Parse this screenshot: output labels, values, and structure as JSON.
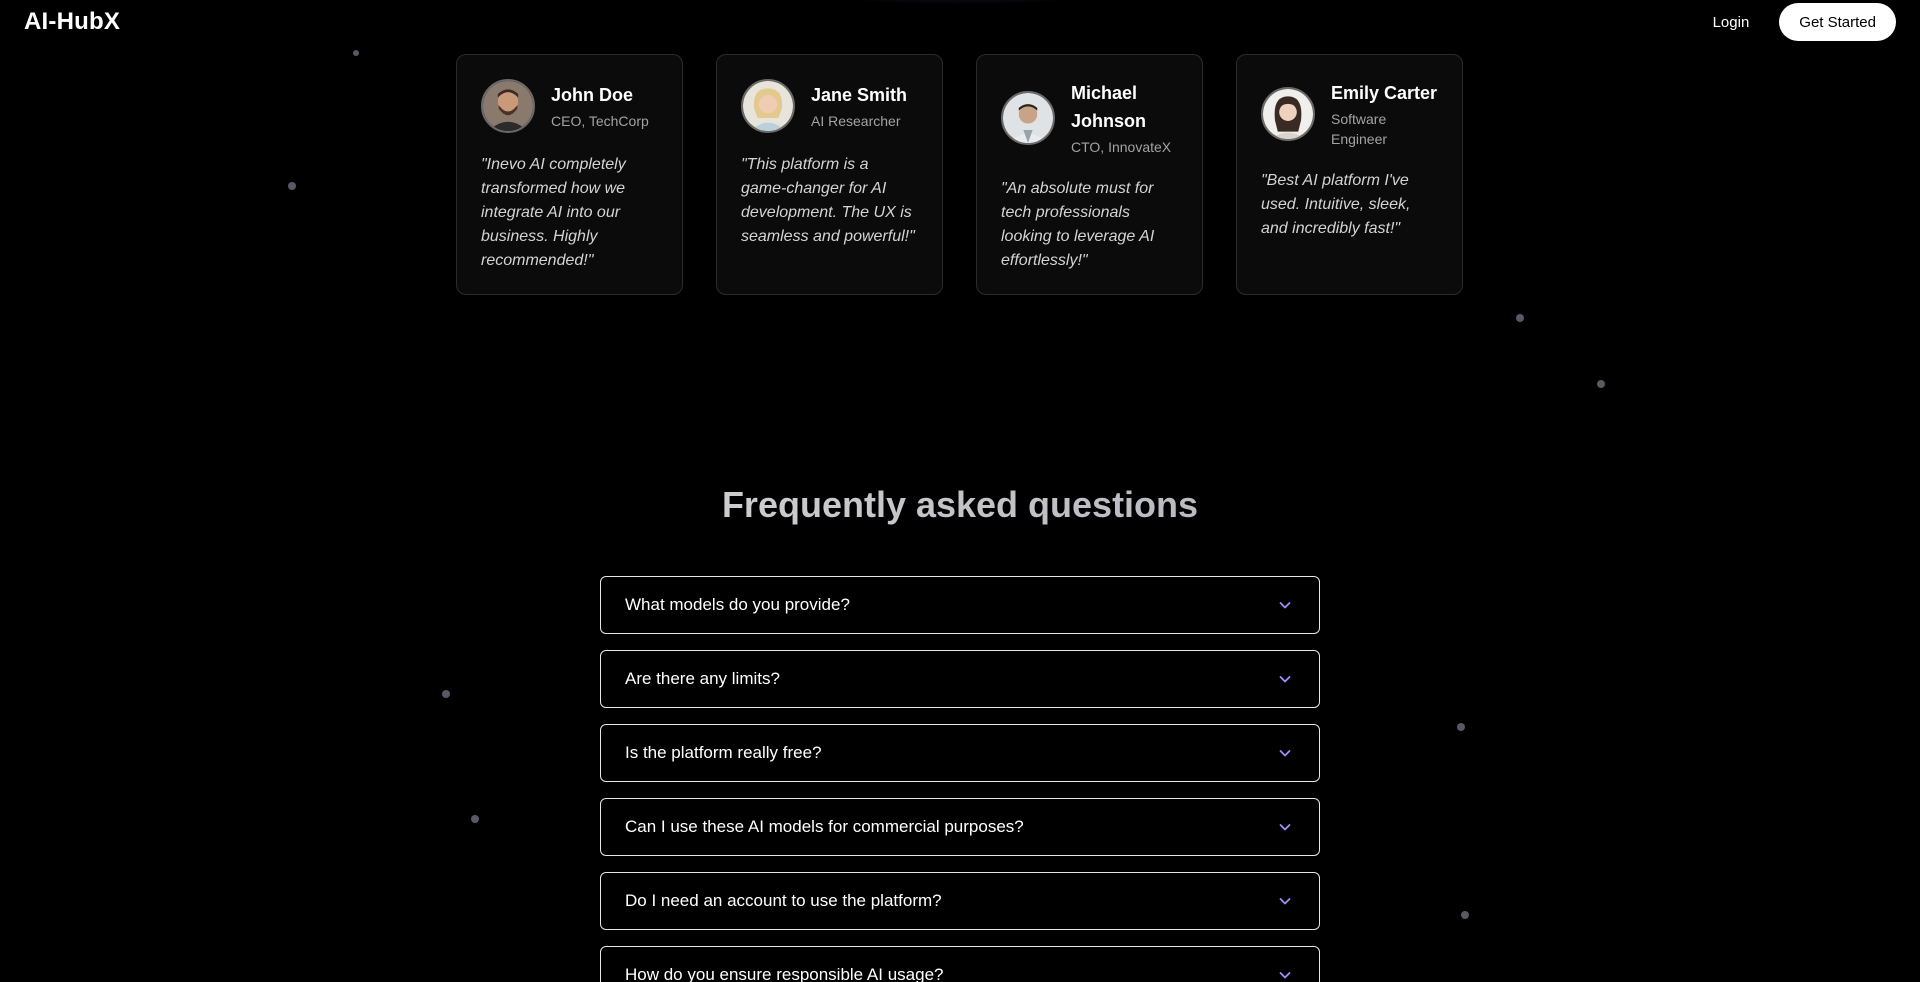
{
  "header": {
    "logo": "AI-HubX",
    "login_label": "Login",
    "cta_label": "Get Started"
  },
  "testimonials": [
    {
      "name": "John Doe",
      "role": "CEO, TechCorp",
      "quote": "\"Inevo AI completely transformed how we integrate AI into our business. Highly recommended!\""
    },
    {
      "name": "Jane Smith",
      "role": "AI Researcher",
      "quote": "\"This platform is a game-changer for AI development. The UX is seamless and powerful!\""
    },
    {
      "name": "Michael Johnson",
      "role": "CTO, InnovateX",
      "quote": "\"An absolute must for tech professionals looking to leverage AI effortlessly!\""
    },
    {
      "name": "Emily Carter",
      "role": "Software Engineer",
      "quote": "\"Best AI platform I've used. Intuitive, sleek, and incredibly fast!\""
    }
  ],
  "faq": {
    "title": "Frequently asked questions",
    "items": [
      "What models do you provide?",
      "Are there any limits?",
      "Is the platform really free?",
      "Can I use these AI models for commercial purposes?",
      "Do I need an account to use the platform?",
      "How do you ensure responsible AI usage?"
    ]
  },
  "colors": {
    "background": "#000000",
    "card_background": "#0b0b0b",
    "chevron_accent": "#a78bfa"
  },
  "icons": {
    "faq_toggle": "chevron-down-icon"
  }
}
